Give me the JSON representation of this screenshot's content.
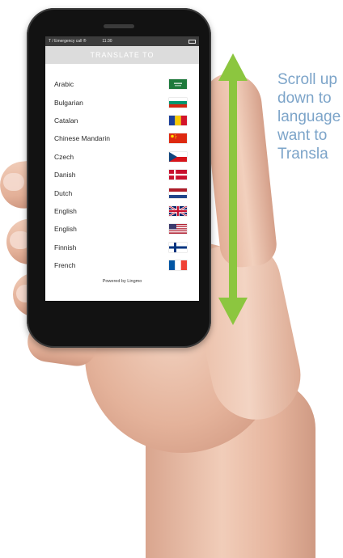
{
  "phone": {
    "status": {
      "carrier": "T / Emergency call ®",
      "time": "11:30"
    },
    "app_title": "TRANSLATE TO",
    "languages": [
      {
        "name": "Arabic",
        "flag": "saudi-arabia-flag"
      },
      {
        "name": "Bulgarian",
        "flag": "bulgaria-flag"
      },
      {
        "name": "Catalan",
        "flag": "catalonia-flag"
      },
      {
        "name": "Chinese Mandarin",
        "flag": "china-flag"
      },
      {
        "name": "Czech",
        "flag": "czech-flag"
      },
      {
        "name": "Danish",
        "flag": "denmark-flag"
      },
      {
        "name": "Dutch",
        "flag": "netherlands-flag"
      },
      {
        "name": "English",
        "flag": "united-kingdom-flag"
      },
      {
        "name": "English",
        "flag": "united-states-flag"
      },
      {
        "name": "Finnish",
        "flag": "finland-flag"
      },
      {
        "name": "French",
        "flag": "france-flag"
      }
    ],
    "powered_by": "Powered by Lingmo"
  },
  "annotation": {
    "lines": [
      "Scroll up",
      "down to",
      "language",
      "want to",
      "Transla"
    ]
  },
  "colors": {
    "arrow": "#8cc63f",
    "note_text": "#7ca4c9"
  }
}
